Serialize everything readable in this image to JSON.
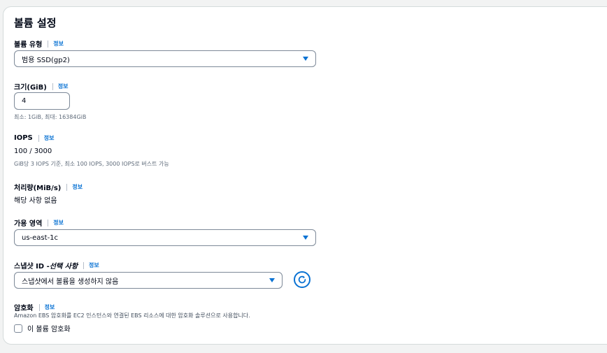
{
  "section": {
    "title": "볼륨 설정"
  },
  "info_label": "정보",
  "volume_type": {
    "label": "볼륨 유형",
    "value": "범용 SSD(gp2)"
  },
  "size": {
    "label": "크기(GiB)",
    "value": "4",
    "help": "최소: 1GiB, 최대: 16384GiB"
  },
  "iops": {
    "label": "IOPS",
    "value": "100 / 3000",
    "help": "GiB당 3 IOPS 기준, 최소 100 IOPS, 3000 IOPS로 버스트 가능"
  },
  "throughput": {
    "label": "처리량(MiB/s)",
    "value": "해당 사항 없음"
  },
  "availability_zone": {
    "label": "가용 영역",
    "value": "us-east-1c"
  },
  "snapshot": {
    "label": "스냅샷 ID - ",
    "optional": "선택 사항",
    "value": "스냅샷에서 볼륨을 생성하지 않음"
  },
  "encryption": {
    "label": "암호화",
    "help": "Amazon EBS 암호화를 EC2 인스턴스와 연결된 EBS 리소스에 대한 암호화 솔루션으로 사용합니다.",
    "checkbox_label": "이 볼륨 암호화",
    "checked": false
  },
  "colors": {
    "accent": "#0972d3",
    "text": "#000716",
    "muted": "#5f6b7a",
    "border": "#7d8998"
  },
  "icons": {
    "dropdown": "caret-down-icon",
    "refresh": "refresh-icon"
  }
}
